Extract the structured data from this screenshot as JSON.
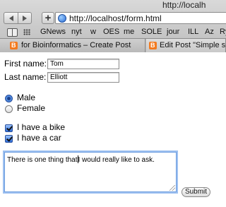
{
  "window": {
    "title": "http://localh"
  },
  "toolbar": {
    "url": "http://localhost/form.html",
    "new_tab_label": "+"
  },
  "bookmarks": [
    "GNews",
    "nyt",
    "w",
    "OES",
    "me",
    "SOLE",
    "jour",
    "ILL",
    "Az",
    "Ry"
  ],
  "tabs": [
    {
      "label": "for Bioinformatics – Create Post"
    },
    {
      "label": "Edit Post \"Simple se"
    }
  ],
  "form": {
    "first_name_label": "First name:",
    "first_name_value": "Tom",
    "last_name_label": "Last name:",
    "last_name_value": "Elliott",
    "sex_options": [
      {
        "label": "Male",
        "selected": true
      },
      {
        "label": "Female",
        "selected": false
      }
    ],
    "vehicle_options": [
      {
        "label": "I have a bike",
        "checked": true
      },
      {
        "label": "I have a car",
        "checked": true
      }
    ],
    "message_before_caret": "There is one thing that",
    "message_after_caret": "I would really like to ask.",
    "submit_label": "Submit"
  }
}
